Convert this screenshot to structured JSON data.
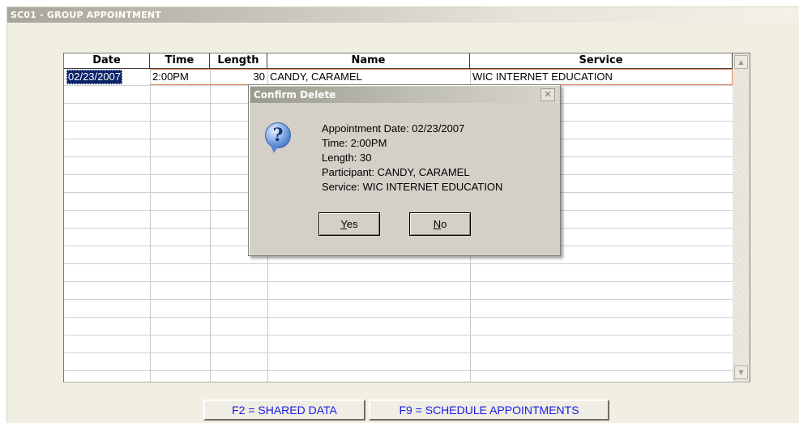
{
  "window": {
    "title": "SC01 - GROUP APPOINTMENT"
  },
  "grid": {
    "columns": [
      "Date",
      "Time",
      "Length",
      "Name",
      "Service"
    ],
    "rows": [
      {
        "date": "02/23/2007",
        "time": "2:00PM",
        "length": "30",
        "name": "CANDY, CARAMEL",
        "service": "WIC INTERNET EDUCATION"
      }
    ],
    "scroll_up_icon": "scroll-up-arrow",
    "scroll_down_icon": "scroll-down-arrow"
  },
  "dialog": {
    "title": "Confirm Delete",
    "close_symbol": "✕",
    "icon": "question-icon",
    "icon_glyph": "?",
    "lines": [
      "Appointment Date: 02/23/2007",
      "Time:  2:00PM",
      "Length:  30",
      "Participant: CANDY, CARAMEL",
      "Service: WIC INTERNET EDUCATION"
    ],
    "yes": {
      "mnemonic": "Y",
      "rest": "es"
    },
    "no": {
      "mnemonic": "N",
      "rest": "o"
    }
  },
  "fkeys": {
    "f2": "F2 =  SHARED DATA",
    "f9": "F9 = SCHEDULE APPOINTMENTS"
  },
  "colors": {
    "selection": "#0a246a",
    "fkey_text": "#1a1ae6",
    "row_highlight_border": "#e8865a"
  }
}
